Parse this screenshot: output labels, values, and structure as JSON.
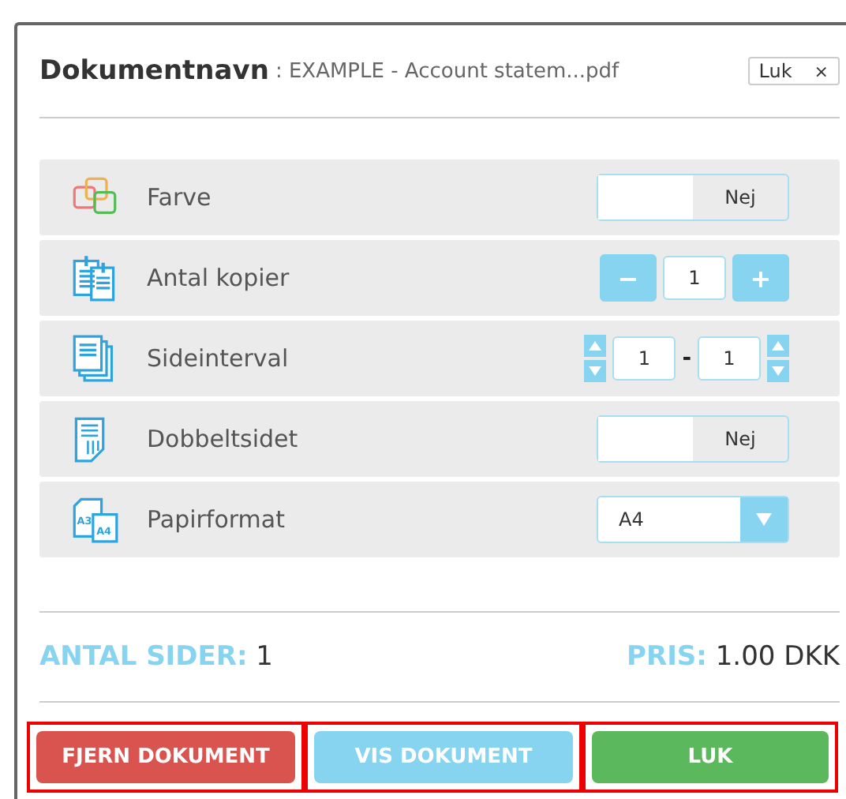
{
  "header": {
    "label": "Dokumentnavn",
    "filename": ": EXAMPLE - Account statem...pdf",
    "close_label": "Luk",
    "close_glyph": "×"
  },
  "options": [
    {
      "kind": "toggle",
      "label": "Farve",
      "on": false,
      "value": "Nej"
    },
    {
      "kind": "stepper",
      "label": "Antal kopier",
      "minus": "−",
      "value": "1",
      "plus": "+"
    },
    {
      "kind": "range",
      "label": "Sideinterval",
      "from": "1",
      "separator": "-",
      "to": "1"
    },
    {
      "kind": "toggle",
      "label": "Dobbeltsidet",
      "on": false,
      "value": "Nej"
    },
    {
      "kind": "select",
      "label": "Papirformat",
      "icon_labels": [
        "A3",
        "A4"
      ],
      "value": "A4"
    }
  ],
  "summary": {
    "pages_label": "ANTAL SIDER:",
    "pages": "1",
    "price_label": "PRIS:",
    "price": "1.00 DKK"
  },
  "buttons": [
    {
      "kind": "danger",
      "label": "FJERN DOKUMENT"
    },
    {
      "kind": "info",
      "label": "VIS DOKUMENT"
    },
    {
      "kind": "success",
      "label": "LUK"
    }
  ]
}
